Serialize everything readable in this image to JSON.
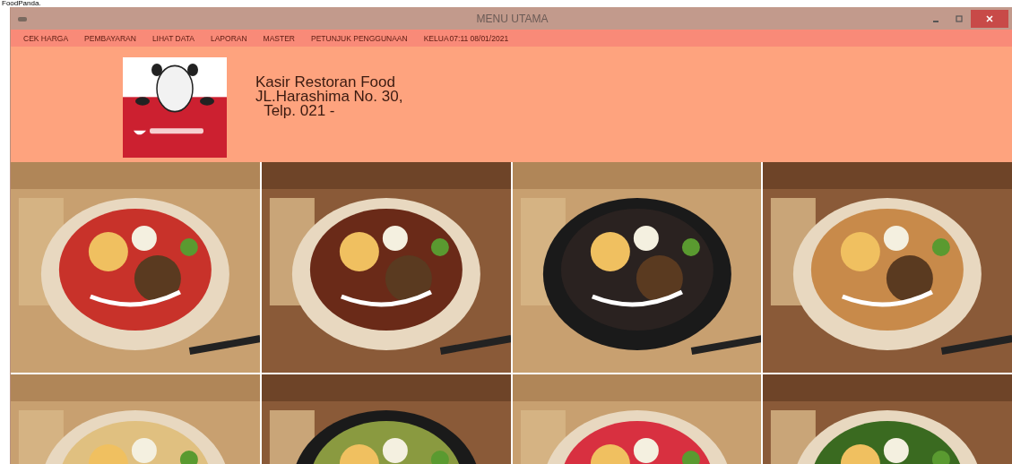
{
  "caption": "FoodPanda.",
  "window": {
    "title": "MENU UTAMA"
  },
  "menu": [
    {
      "label": "CEK HARGA"
    },
    {
      "label": "PEMBAYARAN"
    },
    {
      "label": "LIHAT DATA"
    },
    {
      "label": "LAPORAN"
    },
    {
      "label": "MASTER"
    },
    {
      "label": "PETUNJUK PENGGUNAAN"
    },
    {
      "label": "KELUA"
    }
  ],
  "clock": "07:11 08/01/2021",
  "header": {
    "lines": [
      "Kasir Restoran Food",
      "JL.Harashima No. 30,",
      "  Telp. 021 -"
    ]
  }
}
